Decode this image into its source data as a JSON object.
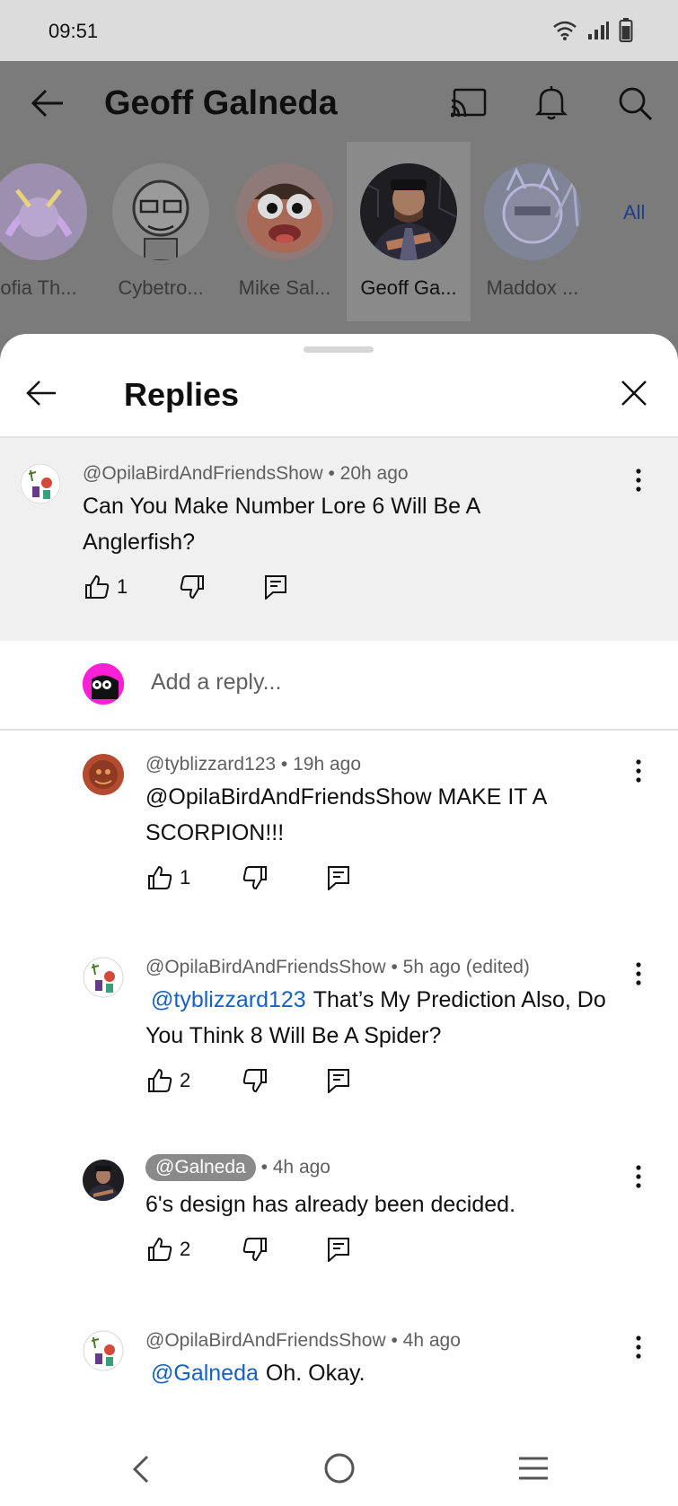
{
  "status": {
    "time": "09:51"
  },
  "header": {
    "title": "Geoff Galneda",
    "subscriptions": [
      {
        "name": "ofia Th...",
        "active": false
      },
      {
        "name": "Cybetro...",
        "active": false
      },
      {
        "name": "Mike Sal...",
        "active": false
      },
      {
        "name": "Geoff Ga...",
        "active": true
      },
      {
        "name": "Maddox ...",
        "active": false
      }
    ],
    "all_label": "All"
  },
  "sheet": {
    "title": "Replies",
    "reply_placeholder": "Add a reply...",
    "parent": {
      "author": "@OpilaBirdAndFriendsShow",
      "time": "• 20h ago",
      "text": "Can You Make Number Lore 6 Will Be A Anglerfish?",
      "likes": "1"
    },
    "replies": [
      {
        "author": "@tyblizzard123",
        "time": "• 19h ago",
        "mention": "",
        "text": "@OpilaBirdAndFriendsShow MAKE IT A SCORPION!!!",
        "likes": "1"
      },
      {
        "author": "@OpilaBirdAndFriendsShow",
        "time": "• 5h ago (edited)",
        "mention": "@tyblizzard123",
        "text": "That’s My Prediction Also, Do You Think 8 Will Be A Spider?",
        "likes": "2"
      },
      {
        "author": "@Galneda",
        "time": "• 4h ago",
        "mention": "",
        "text": "6's design has already been decided.",
        "likes": "2"
      },
      {
        "author": "@OpilaBirdAndFriendsShow",
        "time": "• 4h ago",
        "mention": "@Galneda",
        "text": "Oh. Okay.",
        "likes": ""
      }
    ]
  },
  "icons": {
    "back": "arrow-left-icon",
    "cast": "cast-icon",
    "bell": "bell-icon",
    "search": "search-icon",
    "close": "close-icon",
    "more": "more-vert-icon",
    "like": "thumb-up-icon",
    "dislike": "thumb-down-icon",
    "reply": "reply-icon"
  },
  "colors": {
    "mention": "#1760c4",
    "accent": "#1a3f8c",
    "reply_avatar": "#ff1fd6"
  }
}
